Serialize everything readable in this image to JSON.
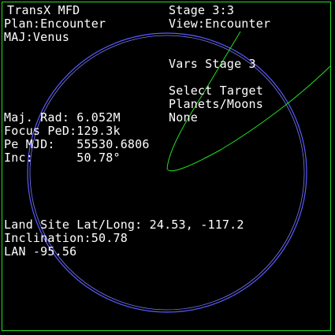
{
  "colors": {
    "background": "#000000",
    "text": "#ffffff",
    "frame": "#22e022",
    "planet_circle": "#5a5aff",
    "trajectory": "#22e022"
  },
  "header": {
    "title": "TransX MFD",
    "stage": "Stage 3:3",
    "plan": "Plan:Encounter",
    "view": "View:Encounter",
    "maj": "MAJ:Venus"
  },
  "vars": {
    "heading": "Vars Stage 3",
    "select_label": "Select Target",
    "select_sub": "Planets/Moons",
    "select_value": "None"
  },
  "params": {
    "maj_rad": "Maj. Rad: 6.052M",
    "focus_ped": "Focus PeD:129.3k",
    "pe_mjd": "Pe MJD:   55530.6806",
    "inc": "Inc:      50.78°"
  },
  "landing": {
    "land_site": "Land Site Lat/Long: 24.53, -117.2",
    "inclination": "Inclination:50.78",
    "lan": "LAN -95.56"
  }
}
